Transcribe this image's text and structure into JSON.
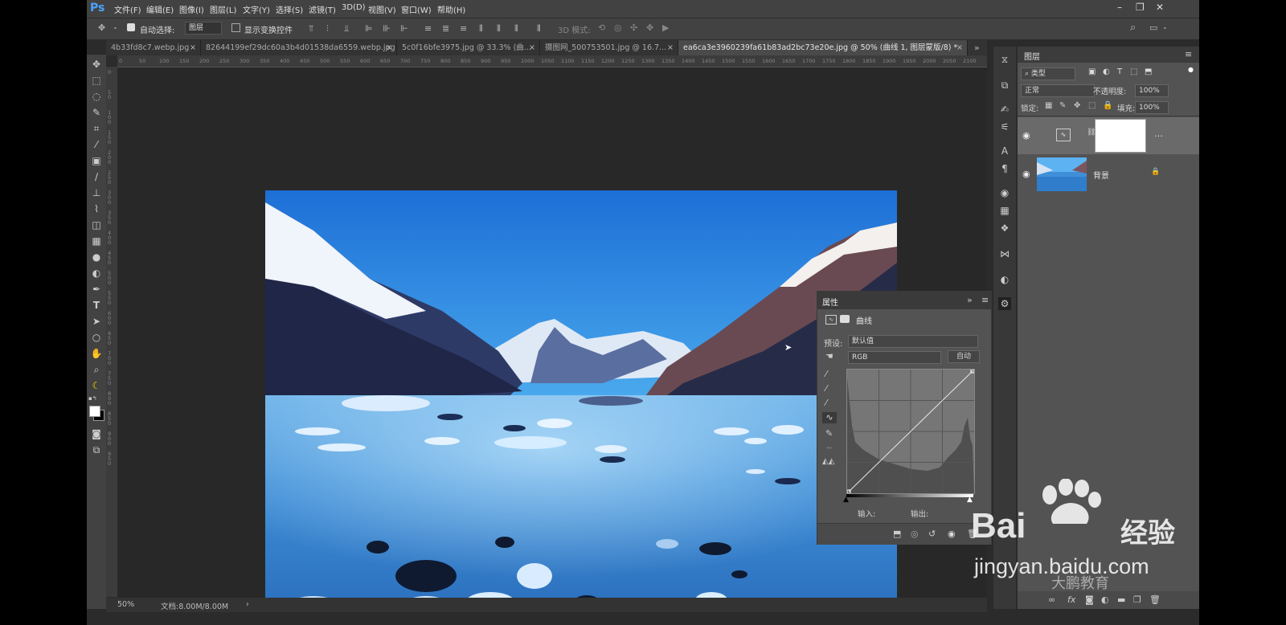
{
  "app": {
    "logo": "Ps",
    "menu": [
      "文件(F)",
      "编辑(E)",
      "图像(I)",
      "图层(L)",
      "文字(Y)",
      "选择(S)",
      "滤镜(T)",
      "3D(D)",
      "视图(V)",
      "窗口(W)",
      "帮助(H)"
    ]
  },
  "options": {
    "auto_select_label": "自动选择:",
    "auto_select_value": "图层",
    "show_transform_label": "显示变换控件",
    "mode_3d_label": "3D 模式:"
  },
  "tabs": [
    {
      "label": "4b33fd8c7.webp.jpg"
    },
    {
      "label": "82644199ef29dc60a3b4d01538da6559.webp.jpg"
    },
    {
      "label": "5c0f16bfe3975.jpg @ 33.3% (曲..."
    },
    {
      "label": "摄图网_500753501.jpg @ 16.7..."
    },
    {
      "label": "ea6ca3e3960239fa61b83ad2bc73e20e.jpg @ 50% (曲线 1, 图层蒙版/8) *",
      "active": true
    }
  ],
  "ruler": {
    "h_ticks": [
      "0",
      "50",
      "100",
      "150",
      "200",
      "250",
      "300",
      "350",
      "400",
      "450",
      "500",
      "550",
      "600",
      "650",
      "700",
      "750",
      "800",
      "850",
      "900",
      "950",
      "1000",
      "1050",
      "1100",
      "1150",
      "1200",
      "1250",
      "1300",
      "1350",
      "1400",
      "1450",
      "1500",
      "1550",
      "1600",
      "1650",
      "1700",
      "1750",
      "1800",
      "1850",
      "1900",
      "1950",
      "2000",
      "2050",
      "2100"
    ],
    "v_ticks": [
      "0",
      "50",
      "100",
      "150",
      "200",
      "250",
      "300",
      "350",
      "400",
      "450",
      "500",
      "550",
      "600",
      "650",
      "700",
      "750",
      "800",
      "850",
      "900",
      "950"
    ]
  },
  "status": {
    "zoom": "50%",
    "doc_info": "文档:8.00M/8.00M",
    "arrow": "›"
  },
  "layers_panel": {
    "title": "图层",
    "filter_label": "类型",
    "blend_mode": "正常",
    "opacity_label": "不透明度:",
    "opacity_value": "100%",
    "lock_label": "锁定:",
    "fill_label": "填充:",
    "fill_value": "100%",
    "layers": [
      {
        "name": "",
        "type": "curves adjustment",
        "mask": "white",
        "selected": true
      },
      {
        "name": "背景",
        "type": "image",
        "locked": true
      }
    ],
    "footer_icons": [
      "link-icon",
      "fx-icon",
      "mask-icon",
      "adjustment-icon",
      "folder-icon",
      "new-layer-icon",
      "trash-icon"
    ]
  },
  "properties_panel": {
    "title": "属性",
    "adjustment_name": "曲线",
    "preset_label": "预设:",
    "preset_value": "默认值",
    "channel_value": "RGB",
    "auto_button": "自动",
    "input_label": "输入:",
    "output_label": "输出:"
  },
  "watermark": {
    "brand_left": "Bai",
    "brand_right": "经验",
    "url": "jingyan.baidu.com",
    "sub": "大鹏教育"
  },
  "colors": {
    "accent": "#4aa3ff",
    "panel_bg": "#535353",
    "workspace": "#282828"
  }
}
